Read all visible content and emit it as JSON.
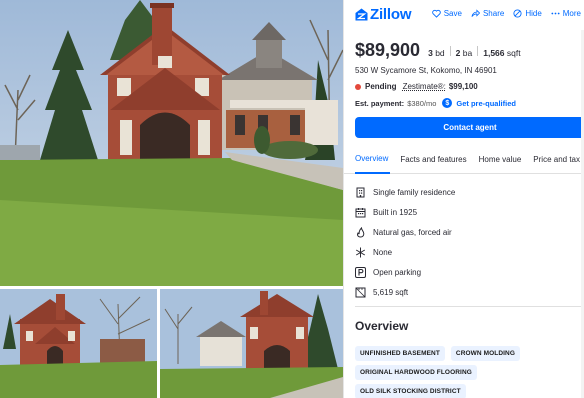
{
  "brand": {
    "name": "Zillow",
    "color": "#006aff"
  },
  "actions": [
    {
      "label": "Save",
      "icon": "heart-icon"
    },
    {
      "label": "Share",
      "icon": "share-icon"
    },
    {
      "label": "Hide",
      "icon": "hide-icon"
    },
    {
      "label": "More",
      "icon": "more-icon"
    }
  ],
  "listing": {
    "price": "$89,900",
    "beds": "3",
    "beds_unit": "bd",
    "baths": "2",
    "baths_unit": "ba",
    "sqft": "1,566",
    "sqft_unit": "sqft",
    "address": "530 W Sycamore St, Kokomo, IN 46901",
    "status": "Pending",
    "status_color": "#e3483b",
    "zestimate_label": "Zestimate®:",
    "zestimate_value": "$99,100",
    "payment_label": "Est. payment:",
    "payment_value": "$380/mo",
    "prequal_label": "Get pre-qualified",
    "contact_label": "Contact agent"
  },
  "tabs": [
    {
      "label": "Overview",
      "active": true
    },
    {
      "label": "Facts and features",
      "active": false
    },
    {
      "label": "Home value",
      "active": false
    },
    {
      "label": "Price and tax h",
      "active": false
    }
  ],
  "facts": [
    {
      "icon": "home-icon",
      "text": "Single family residence"
    },
    {
      "icon": "calendar-icon",
      "text": "Built in 1925"
    },
    {
      "icon": "flame-icon",
      "text": "Natural gas, forced air"
    },
    {
      "icon": "snowflake-icon",
      "text": "None"
    },
    {
      "icon": "parking-icon",
      "text": "Open parking"
    },
    {
      "icon": "ruler-icon",
      "text": "5,619 sqft"
    }
  ],
  "overview": {
    "title": "Overview",
    "tags": [
      "UNFINISHED BASEMENT",
      "CROWN MOLDING",
      "ORIGINAL HARDWOOD FLOORING",
      "OLD SILK STOCKING DISTRICT"
    ]
  }
}
